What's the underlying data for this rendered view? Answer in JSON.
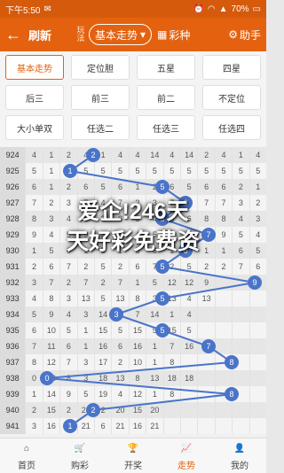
{
  "status": {
    "time": "下午5:50",
    "battery": "70%"
  },
  "header": {
    "back_icon": "back-arrow-icon",
    "refresh": "刷新",
    "play_label": "玩法",
    "dropdown": "基本走势",
    "category": "彩种",
    "help": "助手"
  },
  "options": [
    "基本走势",
    "定位胆",
    "五星",
    "四星",
    "后三",
    "前三",
    "前二",
    "不定位",
    "大小单双",
    "任选二",
    "任选三",
    "任选四"
  ],
  "active_option": 0,
  "rows": [
    {
      "n": "924",
      "c": [
        "4",
        "1",
        "2",
        "4",
        "1",
        "4",
        "4",
        "14",
        "4",
        "14",
        "2",
        "4",
        "1",
        "4"
      ]
    },
    {
      "n": "925",
      "c": [
        "5",
        "1",
        "5",
        "5",
        "5",
        "5",
        "5",
        "5",
        "5",
        "5",
        "5",
        "5",
        "5",
        "5"
      ]
    },
    {
      "n": "926",
      "c": [
        "6",
        "1",
        "2",
        "6",
        "5",
        "6",
        "1",
        "2",
        "6",
        "5",
        "6",
        "6",
        "2",
        "1"
      ]
    },
    {
      "n": "927",
      "c": [
        "7",
        "2",
        "3",
        "7",
        "4",
        "7",
        "2",
        "3",
        "7",
        "4",
        "7",
        "7",
        "3",
        "2"
      ]
    },
    {
      "n": "928",
      "c": [
        "8",
        "3",
        "4",
        "8",
        "2",
        "8",
        "3",
        "4",
        "8",
        "6",
        "8",
        "8",
        "4",
        "3"
      ]
    },
    {
      "n": "929",
      "c": [
        "9",
        "4",
        "5",
        "9",
        "3",
        "9",
        "4",
        "5",
        "9",
        "7",
        "9",
        "9",
        "5",
        "4"
      ]
    },
    {
      "n": "930",
      "c": [
        "1",
        "5",
        "6",
        "1",
        "5",
        "1",
        "5",
        "6",
        "1",
        "5",
        "1",
        "1",
        "6",
        "5"
      ]
    },
    {
      "n": "931",
      "c": [
        "2",
        "6",
        "7",
        "2",
        "5",
        "2",
        "6",
        "7",
        "2",
        "5",
        "2",
        "2",
        "7",
        "6"
      ]
    },
    {
      "n": "932",
      "c": [
        "3",
        "7",
        "2",
        "7",
        "2",
        "7",
        "1",
        "5",
        "12",
        "12",
        "9",
        "",
        "",
        ""
      ]
    },
    {
      "n": "933",
      "c": [
        "4",
        "8",
        "3",
        "13",
        "5",
        "13",
        "8",
        "3",
        "13",
        "4",
        "13",
        "",
        "",
        ""
      ]
    },
    {
      "n": "934",
      "c": [
        "5",
        "9",
        "4",
        "3",
        "14",
        "1",
        "7",
        "14",
        "1",
        "4",
        "",
        "",
        "",
        ""
      ]
    },
    {
      "n": "935",
      "c": [
        "6",
        "10",
        "5",
        "1",
        "15",
        "5",
        "15",
        "5",
        "15",
        "5",
        "",
        "",
        "",
        ""
      ]
    },
    {
      "n": "936",
      "c": [
        "7",
        "11",
        "6",
        "1",
        "16",
        "6",
        "16",
        "1",
        "7",
        "16",
        "",
        "",
        "",
        ""
      ]
    },
    {
      "n": "937",
      "c": [
        "8",
        "12",
        "7",
        "3",
        "17",
        "2",
        "10",
        "1",
        "8",
        "",
        "",
        "",
        "",
        ""
      ]
    },
    {
      "n": "938",
      "c": [
        "0",
        "13",
        "8",
        "3",
        "18",
        "13",
        "8",
        "13",
        "18",
        "18",
        "",
        "",
        "",
        ""
      ]
    },
    {
      "n": "939",
      "c": [
        "1",
        "14",
        "9",
        "5",
        "19",
        "4",
        "12",
        "1",
        "8",
        "",
        "",
        "",
        "",
        ""
      ]
    },
    {
      "n": "940",
      "c": [
        "2",
        "15",
        "2",
        "20",
        "2",
        "20",
        "15",
        "20",
        "",
        "",
        "",
        "",
        "",
        ""
      ]
    },
    {
      "n": "941",
      "c": [
        "3",
        "16",
        "1",
        "21",
        "6",
        "21",
        "16",
        "21",
        "",
        "",
        "",
        "",
        "",
        ""
      ]
    }
  ],
  "overlay": {
    "line1": "爱企!246天",
    "line2": "天好彩免费资"
  },
  "tabs": [
    {
      "label": "首页",
      "icon": "home-icon"
    },
    {
      "label": "购彩",
      "icon": "cart-icon"
    },
    {
      "label": "开奖",
      "icon": "trophy-icon"
    },
    {
      "label": "走势",
      "icon": "chart-icon"
    },
    {
      "label": "我的",
      "icon": "user-icon"
    }
  ],
  "active_tab": 3,
  "colors": {
    "accent": "#e4620f",
    "ball": "#4a74c9"
  }
}
